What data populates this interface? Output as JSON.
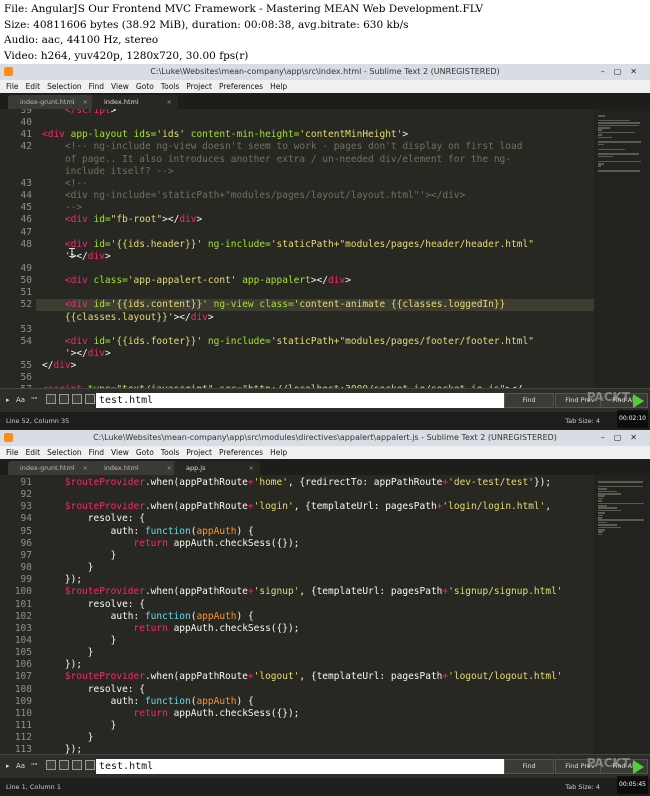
{
  "info": {
    "line1": "File: AngularJS  Our Frontend MVC Framework - Mastering MEAN Web Development.FLV",
    "line2": "Size: 40811606 bytes (38.92 MiB), duration: 00:08:38, avg.bitrate: 630 kb/s",
    "line3": "Audio: aac, 44100 Hz, stereo",
    "line4": "Video: h264, yuv420p, 1280x720, 30.00 fps(r)"
  },
  "colors": {
    "keyword": "#f92672",
    "string": "#e6db74",
    "tag": "#f92672",
    "attr": "#a6e22e",
    "comment": "#75715e",
    "text": "#f8f8f2",
    "func": "#66d9ef",
    "param": "#fd971f"
  },
  "win1": {
    "title": "C:\\Luke\\Websites\\mean-company\\app\\src\\index.html - Sublime Text 2 (UNREGISTERED)",
    "menu": [
      "File",
      "Edit",
      "Selection",
      "Find",
      "View",
      "Goto",
      "Tools",
      "Project",
      "Preferences",
      "Help"
    ],
    "tabs": [
      {
        "label": "index-grunt.html",
        "close": "×"
      },
      {
        "label": "index.html",
        "close": "×"
      }
    ],
    "line_numbers": [
      "39",
      "40",
      "41",
      "42",
      "",
      "",
      "43",
      "44",
      "45",
      "46",
      "47",
      "48",
      "",
      "49",
      "50",
      "51",
      "52",
      "",
      "53",
      "54",
      "",
      "55",
      "56",
      "57"
    ],
    "code": [
      [
        {
          "t": "    </",
          "c": "tag"
        },
        {
          "t": "script",
          "c": "tag"
        },
        {
          "t": ">",
          "c": "text"
        }
      ],
      [],
      [
        {
          "t": "<div ",
          "c": "tag"
        },
        {
          "t": "app-layout ids=",
          "c": "attr"
        },
        {
          "t": "'ids' ",
          "c": "string"
        },
        {
          "t": "content-min-height=",
          "c": "attr"
        },
        {
          "t": "'contentMinHeight'",
          "c": "string"
        },
        {
          "t": ">",
          "c": "text"
        }
      ],
      [
        {
          "t": "    <!-- ng-include ng-view doesn't seem to work - pages don't display on first load",
          "c": "comment"
        }
      ],
      [
        {
          "t": "    of page.. It also introduces another extra / un-needed div/element for the ng-",
          "c": "comment"
        }
      ],
      [
        {
          "t": "    include itself? -->",
          "c": "comment"
        }
      ],
      [
        {
          "t": "    <!--",
          "c": "comment"
        }
      ],
      [
        {
          "t": "    <div ng-include='staticPath+\"modules/pages/layout/layout.html\"'></div>",
          "c": "comment"
        }
      ],
      [
        {
          "t": "    -->",
          "c": "comment"
        }
      ],
      [
        {
          "t": "    <div ",
          "c": "tag"
        },
        {
          "t": "id=",
          "c": "attr"
        },
        {
          "t": "\"fb-root\"",
          "c": "string"
        },
        {
          "t": "></",
          "c": "text"
        },
        {
          "t": "div",
          "c": "tag"
        },
        {
          "t": ">",
          "c": "text"
        }
      ],
      [],
      [
        {
          "t": "    <div ",
          "c": "tag"
        },
        {
          "t": "id=",
          "c": "attr"
        },
        {
          "t": "'{{ids.header}}' ",
          "c": "string"
        },
        {
          "t": "ng-include=",
          "c": "attr"
        },
        {
          "t": "'staticPath+\"modules/pages/header/header.html\"",
          "c": "string"
        }
      ],
      [
        {
          "t": "    '",
          "c": "string"
        },
        {
          "t": "></",
          "c": "text"
        },
        {
          "t": "div",
          "c": "tag"
        },
        {
          "t": ">",
          "c": "text"
        }
      ],
      [],
      [
        {
          "t": "    <div ",
          "c": "tag"
        },
        {
          "t": "class=",
          "c": "attr"
        },
        {
          "t": "'app-appalert-cont' ",
          "c": "string"
        },
        {
          "t": "app-appalert",
          "c": "attr"
        },
        {
          "t": "></",
          "c": "text"
        },
        {
          "t": "div",
          "c": "tag"
        },
        {
          "t": ">",
          "c": "text"
        }
      ],
      [],
      [
        {
          "t": "    <div ",
          "c": "tag"
        },
        {
          "t": "id=",
          "c": "attr"
        },
        {
          "t": "'{{ids.content}}' ",
          "c": "string"
        },
        {
          "t": "ng-view ",
          "c": "attr"
        },
        {
          "t": "class=",
          "c": "attr"
        },
        {
          "t": "'content-animate {{classes.loggedIn}}",
          "c": "string"
        }
      ],
      [
        {
          "t": "    {{classes.layout}}'",
          "c": "string"
        },
        {
          "t": "></",
          "c": "text"
        },
        {
          "t": "div",
          "c": "tag"
        },
        {
          "t": ">",
          "c": "text"
        }
      ],
      [],
      [
        {
          "t": "    <div ",
          "c": "tag"
        },
        {
          "t": "id=",
          "c": "attr"
        },
        {
          "t": "'{{ids.footer}}' ",
          "c": "string"
        },
        {
          "t": "ng-include=",
          "c": "attr"
        },
        {
          "t": "'staticPath+\"modules/pages/footer/footer.html\"",
          "c": "string"
        }
      ],
      [
        {
          "t": "    '",
          "c": "string"
        },
        {
          "t": "></",
          "c": "text"
        },
        {
          "t": "div",
          "c": "tag"
        },
        {
          "t": ">",
          "c": "text"
        }
      ],
      [
        {
          "t": "</",
          "c": "text"
        },
        {
          "t": "div",
          "c": "tag"
        },
        {
          "t": ">",
          "c": "text"
        }
      ],
      [],
      [
        {
          "t": "<script ",
          "c": "tag"
        },
        {
          "t": "type=",
          "c": "attr"
        },
        {
          "t": "\"text/javascript\" ",
          "c": "string"
        },
        {
          "t": "src=",
          "c": "attr"
        },
        {
          "t": "\"http://localhost:3000/socket.io/socket.io.js\"",
          "c": "string"
        },
        {
          "t": "></",
          "c": "text"
        }
      ]
    ],
    "find_value": "test.html",
    "find_options": [
      "Aa",
      "\"\""
    ],
    "buttons": [
      "Find",
      "Find Prev",
      "Find All"
    ],
    "status_left": "Line 52, Column 35",
    "status_right": "Tab Size: 4",
    "timestamp": "00:02:10"
  },
  "win2": {
    "title": "C:\\Luke\\Websites\\mean-company\\app\\src\\modules\\directives\\appalert\\appalert.js - Sublime Text 2 (UNREGISTERED)",
    "menu": [
      "File",
      "Edit",
      "Selection",
      "Find",
      "View",
      "Goto",
      "Tools",
      "Project",
      "Preferences",
      "Help"
    ],
    "tabs": [
      {
        "label": "index-grunt.html",
        "close": "×"
      },
      {
        "label": "index.html",
        "close": "×"
      },
      {
        "label": "app.js",
        "close": "×"
      }
    ],
    "line_numbers": [
      "91",
      "92",
      "93",
      "94",
      "95",
      "96",
      "97",
      "98",
      "99",
      "100",
      "101",
      "102",
      "103",
      "104",
      "105",
      "106",
      "107",
      "108",
      "109",
      "110",
      "111",
      "112",
      "113"
    ],
    "code": [
      [
        {
          "t": "    $routeProvider",
          "c": "keyword"
        },
        {
          "t": ".when(appPathRoute",
          "c": "text"
        },
        {
          "t": "+",
          "c": "keyword"
        },
        {
          "t": "'home'",
          "c": "string"
        },
        {
          "t": ", {redirectTo: appPathRoute",
          "c": "text"
        },
        {
          "t": "+",
          "c": "keyword"
        },
        {
          "t": "'dev-test/test'",
          "c": "string"
        },
        {
          "t": "});",
          "c": "text"
        }
      ],
      [],
      [
        {
          "t": "    $routeProvider",
          "c": "keyword"
        },
        {
          "t": ".when(appPathRoute",
          "c": "text"
        },
        {
          "t": "+",
          "c": "keyword"
        },
        {
          "t": "'login'",
          "c": "string"
        },
        {
          "t": ", {templateUrl: pagesPath",
          "c": "text"
        },
        {
          "t": "+",
          "c": "keyword"
        },
        {
          "t": "'login/login.html'",
          "c": "string"
        },
        {
          "t": ",",
          "c": "text"
        }
      ],
      [
        {
          "t": "        resolve: {",
          "c": "text"
        }
      ],
      [
        {
          "t": "            auth: ",
          "c": "text"
        },
        {
          "t": "function",
          "c": "func"
        },
        {
          "t": "(",
          "c": "text"
        },
        {
          "t": "appAuth",
          "c": "param"
        },
        {
          "t": ") {",
          "c": "text"
        }
      ],
      [
        {
          "t": "                ",
          "c": "text"
        },
        {
          "t": "return",
          "c": "keyword"
        },
        {
          "t": " appAuth.checkSess({});",
          "c": "text"
        }
      ],
      [
        {
          "t": "            }",
          "c": "text"
        }
      ],
      [
        {
          "t": "        }",
          "c": "text"
        }
      ],
      [
        {
          "t": "    });",
          "c": "text"
        }
      ],
      [
        {
          "t": "    $routeProvider",
          "c": "keyword"
        },
        {
          "t": ".when(appPathRoute",
          "c": "text"
        },
        {
          "t": "+",
          "c": "keyword"
        },
        {
          "t": "'signup'",
          "c": "string"
        },
        {
          "t": ", {templateUrl: pagesPath",
          "c": "text"
        },
        {
          "t": "+",
          "c": "keyword"
        },
        {
          "t": "'signup/signup.html'",
          "c": "string"
        }
      ],
      [
        {
          "t": "        resolve: {",
          "c": "text"
        }
      ],
      [
        {
          "t": "            auth: ",
          "c": "text"
        },
        {
          "t": "function",
          "c": "func"
        },
        {
          "t": "(",
          "c": "text"
        },
        {
          "t": "appAuth",
          "c": "param"
        },
        {
          "t": ") {",
          "c": "text"
        }
      ],
      [
        {
          "t": "                ",
          "c": "text"
        },
        {
          "t": "return",
          "c": "keyword"
        },
        {
          "t": " appAuth.checkSess({});",
          "c": "text"
        }
      ],
      [
        {
          "t": "            }",
          "c": "text"
        }
      ],
      [
        {
          "t": "        }",
          "c": "text"
        }
      ],
      [
        {
          "t": "    });",
          "c": "text"
        }
      ],
      [
        {
          "t": "    $routeProvider",
          "c": "keyword"
        },
        {
          "t": ".when(appPathRoute",
          "c": "text"
        },
        {
          "t": "+",
          "c": "keyword"
        },
        {
          "t": "'logout'",
          "c": "string"
        },
        {
          "t": ", {templateUrl: pagesPath",
          "c": "text"
        },
        {
          "t": "+",
          "c": "keyword"
        },
        {
          "t": "'logout/logout.html'",
          "c": "string"
        }
      ],
      [
        {
          "t": "        resolve: {",
          "c": "text"
        }
      ],
      [
        {
          "t": "            auth: ",
          "c": "text"
        },
        {
          "t": "function",
          "c": "func"
        },
        {
          "t": "(",
          "c": "text"
        },
        {
          "t": "appAuth",
          "c": "param"
        },
        {
          "t": ") {",
          "c": "text"
        }
      ],
      [
        {
          "t": "                ",
          "c": "text"
        },
        {
          "t": "return",
          "c": "keyword"
        },
        {
          "t": " appAuth.checkSess({});",
          "c": "text"
        }
      ],
      [
        {
          "t": "            }",
          "c": "text"
        }
      ],
      [
        {
          "t": "        }",
          "c": "text"
        }
      ],
      [
        {
          "t": "    });",
          "c": "text"
        }
      ]
    ],
    "find_value": "test.html",
    "find_options": [
      "Aa",
      "\"\""
    ],
    "buttons": [
      "Find",
      "Find Prev",
      "Find All"
    ],
    "status_left": "Line 1, Column 1",
    "status_right": "Tab Size: 4",
    "timestamp": "00:05:45"
  }
}
